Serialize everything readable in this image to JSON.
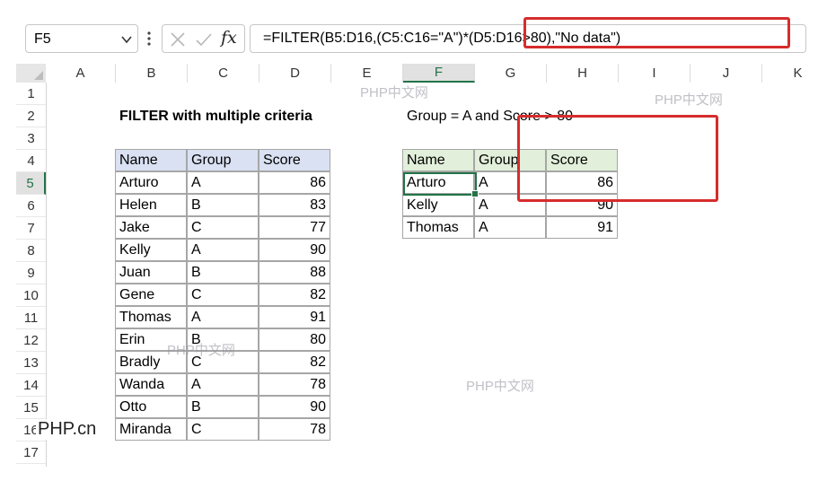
{
  "formula_bar": {
    "name_box": "F5",
    "fx_label": "fx",
    "formula": "=FILTER(B5:D16,(C5:C16=\"A\")*(D5:D16>80),\"No data\")"
  },
  "columns": [
    "A",
    "B",
    "C",
    "D",
    "E",
    "F",
    "G",
    "H",
    "I",
    "J",
    "K"
  ],
  "rows": [
    "1",
    "2",
    "3",
    "4",
    "5",
    "6",
    "7",
    "8",
    "9",
    "10",
    "11",
    "12",
    "13",
    "14",
    "15",
    "16",
    "17"
  ],
  "sheet": {
    "title_left": "FILTER with multiple criteria",
    "title_right": "Group = A and Score > 80",
    "source_headers": [
      "Name",
      "Group",
      "Score"
    ],
    "source_rows": [
      [
        "Arturo",
        "A",
        "86"
      ],
      [
        "Helen",
        "B",
        "83"
      ],
      [
        "Jake",
        "C",
        "77"
      ],
      [
        "Kelly",
        "A",
        "90"
      ],
      [
        "Juan",
        "B",
        "88"
      ],
      [
        "Gene",
        "C",
        "82"
      ],
      [
        "Thomas",
        "A",
        "91"
      ],
      [
        "Erin",
        "B",
        "80"
      ],
      [
        "Bradly",
        "C",
        "82"
      ],
      [
        "Wanda",
        "A",
        "78"
      ],
      [
        "Otto",
        "B",
        "90"
      ],
      [
        "Miranda",
        "C",
        "78"
      ]
    ],
    "result_headers": [
      "Name",
      "Group",
      "Score"
    ],
    "result_rows": [
      [
        "Arturo",
        "A",
        "86"
      ],
      [
        "Kelly",
        "A",
        "90"
      ],
      [
        "Thomas",
        "A",
        "91"
      ]
    ]
  },
  "watermarks": [
    "PHP中文网",
    "PHP中文网",
    "PHP中文网",
    "PHP中文网"
  ],
  "logo_text": "PHP.cn",
  "colors": {
    "source_header_fill": "#d9e1f2",
    "result_header_fill": "#e2efda",
    "active_cell_border": "#217346",
    "annotation_red": "#d62c2c"
  }
}
